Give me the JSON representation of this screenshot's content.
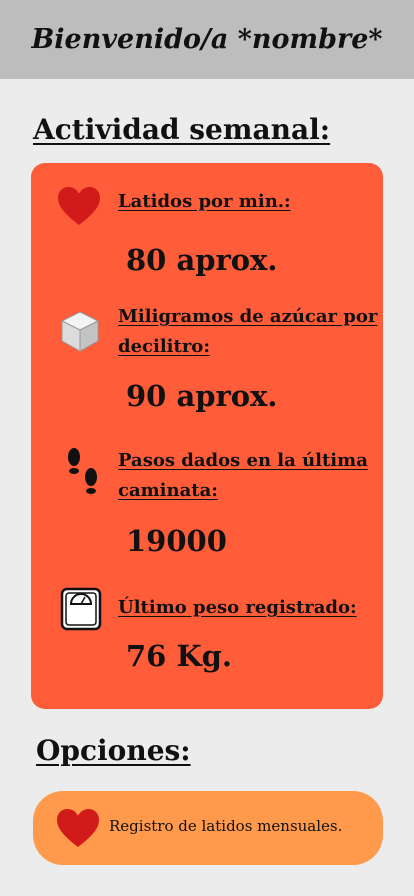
{
  "header": {
    "title": "Bienvenido/a *nombre*"
  },
  "activity": {
    "title": "Actividad semanal:",
    "metrics": [
      {
        "icon": "heart-icon",
        "label": "Latidos por min.:",
        "value": "80 aprox."
      },
      {
        "icon": "sugar-cube-icon",
        "label": "Miligramos de azúcar por decilitro:",
        "value": "90 aprox."
      },
      {
        "icon": "footprints-icon",
        "label": "Pasos dados en la última caminata:",
        "value": "19000"
      },
      {
        "icon": "scale-icon",
        "label": "Último peso registrado:",
        "value": "76 Kg."
      }
    ]
  },
  "options": {
    "title": "Opciones:",
    "items": [
      {
        "icon": "heart-icon",
        "label": "Registro de latidos mensuales."
      }
    ]
  },
  "colors": {
    "header_bg": "#bdbdbd",
    "page_bg": "#ececec",
    "card_bg": "#ff5c3a",
    "option_bg": "#ff9a4c",
    "heart": "#d11a1a"
  }
}
